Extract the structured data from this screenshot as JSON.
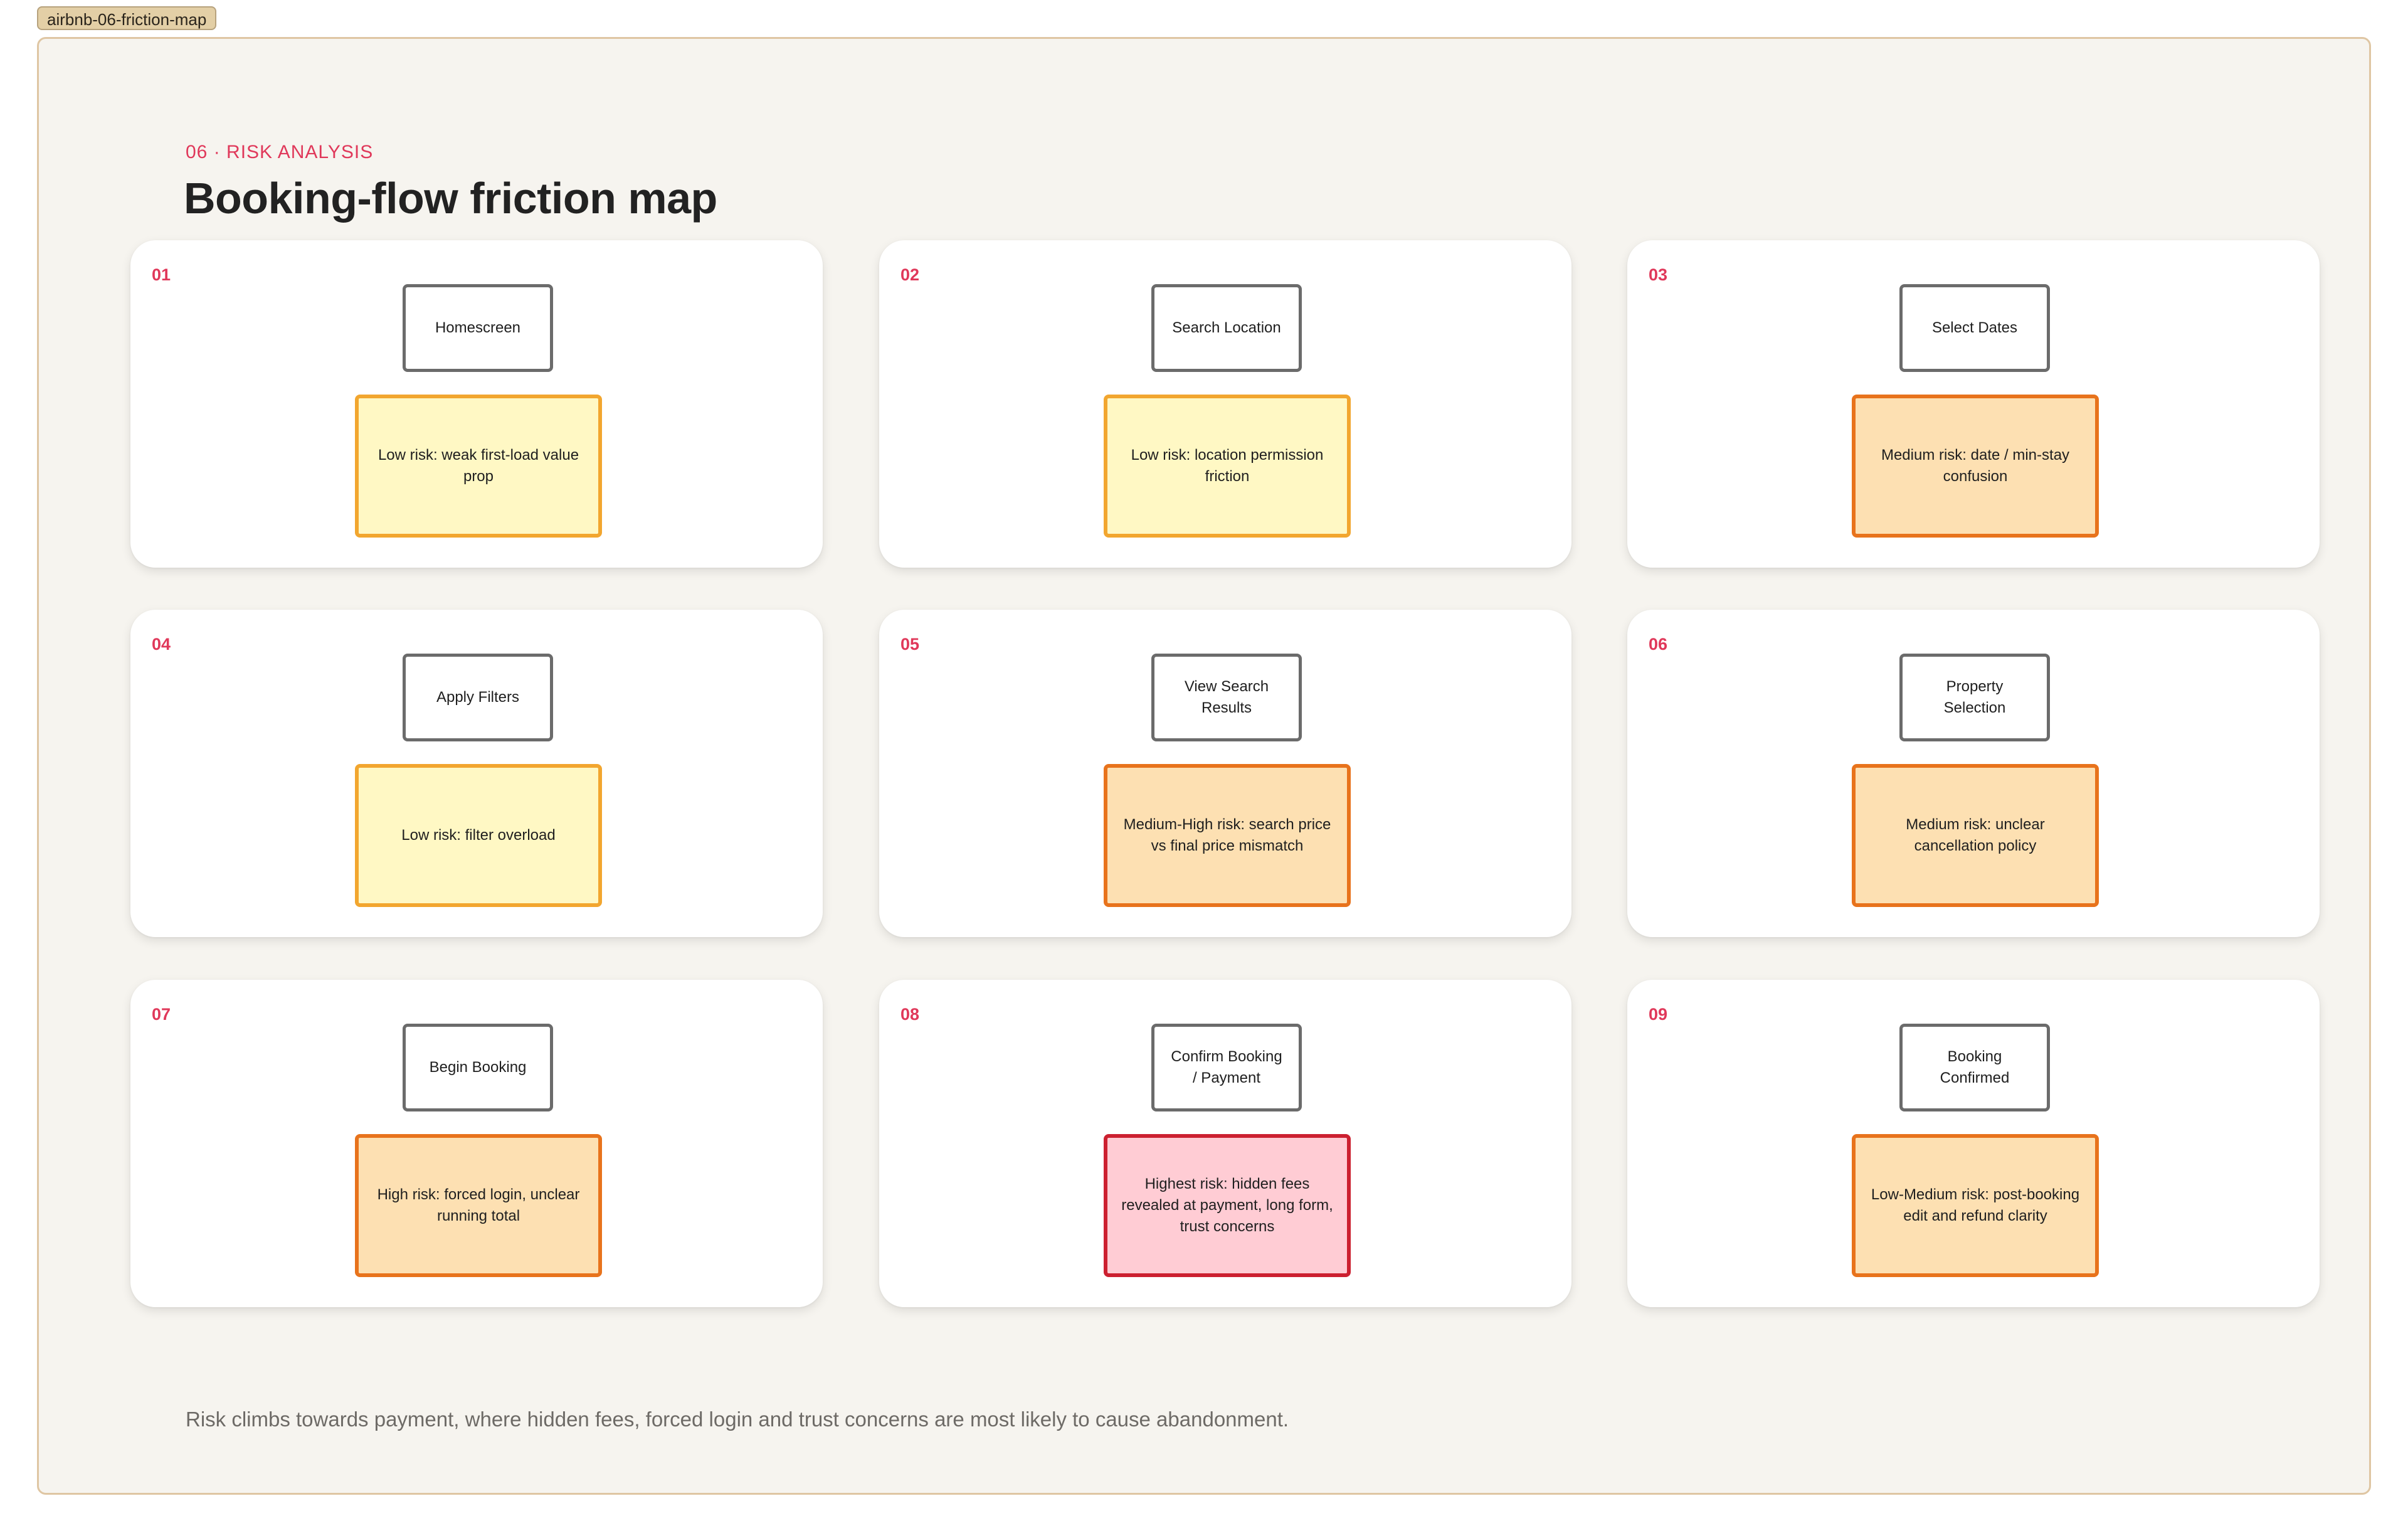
{
  "frame": {
    "tag": "airbnb-06-friction-map"
  },
  "header": {
    "eyebrow": "06 · RISK ANALYSIS",
    "title": "Booking-flow friction map"
  },
  "steps": [
    {
      "num": "01",
      "step": "Homescreen",
      "risk": "Low risk: weak first-load value prop",
      "level": "low"
    },
    {
      "num": "02",
      "step": "Search Location",
      "risk": "Low risk: location permission friction",
      "level": "low"
    },
    {
      "num": "03",
      "step": "Select Dates",
      "risk": "Medium risk: date / min-stay confusion",
      "level": "medium"
    },
    {
      "num": "04",
      "step": "Apply Filters",
      "risk": "Low risk: filter overload",
      "level": "low"
    },
    {
      "num": "05",
      "step": "View Search Results",
      "risk": "Medium-High risk: search price vs final price mismatch",
      "level": "medium"
    },
    {
      "num": "06",
      "step": "Property Selection",
      "risk": "Medium risk: unclear cancellation policy",
      "level": "medium"
    },
    {
      "num": "07",
      "step": "Begin Booking",
      "risk": "High risk: forced login, unclear running total",
      "level": "medium"
    },
    {
      "num": "08",
      "step": "Confirm Booking / Payment",
      "risk": "Highest risk: hidden fees revealed at payment, long form, trust concerns",
      "level": "high"
    },
    {
      "num": "09",
      "step": "Booking Confirmed",
      "risk": "Low-Medium risk: post-booking edit and refund clarity",
      "level": "medium"
    }
  ],
  "colors": {
    "accent": "#e0385a",
    "low_border": "#f2a62f",
    "low_fill": "#fff8c4",
    "medium_border": "#e8731c",
    "medium_fill": "#fde0b2",
    "high_border": "#cc2030",
    "high_fill": "#ffccd4"
  },
  "footer": {
    "note": "Risk climbs towards payment, where hidden fees, forced login and trust concerns are most likely to cause abandonment."
  }
}
